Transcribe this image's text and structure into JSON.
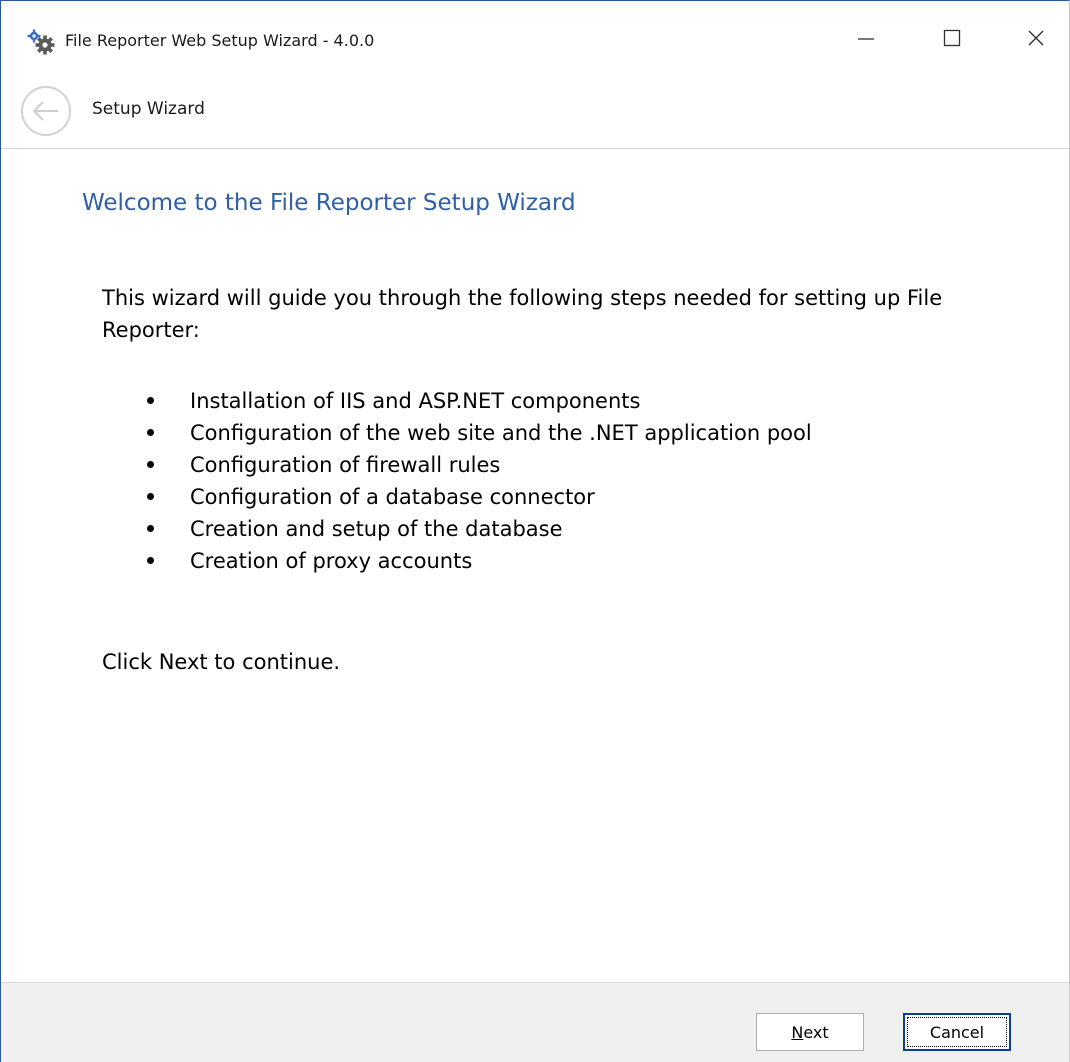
{
  "window": {
    "title": "File Reporter Web Setup Wizard - 4.0.0",
    "icon": "gears-icon",
    "controls": {
      "minimize": "minimize-icon",
      "maximize": "maximize-icon",
      "close": "close-icon"
    }
  },
  "nav": {
    "back_icon": "back-arrow-icon",
    "title": "Setup Wizard"
  },
  "main": {
    "heading": "Welcome to the File Reporter Setup Wizard",
    "intro": "This wizard will guide you through the following steps needed for setting up File Reporter:",
    "steps": [
      "Installation of IIS and ASP.NET components",
      "Configuration of the web site and the .NET application pool",
      "Configuration of firewall rules",
      "Configuration of a database connector",
      "Creation and setup of the database",
      "Creation of proxy accounts"
    ],
    "continue": "Click Next to continue."
  },
  "footer": {
    "next_mnemonic": "N",
    "next_rest": "ext",
    "cancel": "Cancel"
  },
  "colors": {
    "heading": "#2e5fa7",
    "window_border": "#2b579a",
    "default_button_border": "#0b3f96",
    "footer_bg": "#f0f0f0"
  }
}
